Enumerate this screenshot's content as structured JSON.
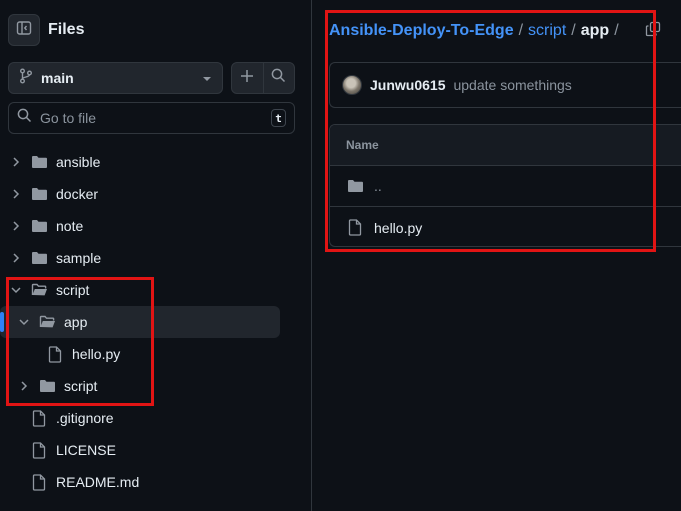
{
  "sidebar": {
    "title": "Files",
    "branch": "main",
    "search_placeholder": "Go to file",
    "search_shortcut": "t",
    "tree": [
      {
        "label": "ansible",
        "type": "folder",
        "expanded": false,
        "depth": 0
      },
      {
        "label": "docker",
        "type": "folder",
        "expanded": false,
        "depth": 0
      },
      {
        "label": "note",
        "type": "folder",
        "expanded": false,
        "depth": 0
      },
      {
        "label": "sample",
        "type": "folder",
        "expanded": false,
        "depth": 0
      },
      {
        "label": "script",
        "type": "folder",
        "expanded": true,
        "depth": 0
      },
      {
        "label": "app",
        "type": "folder",
        "expanded": true,
        "depth": 1,
        "selected": true
      },
      {
        "label": "hello.py",
        "type": "file",
        "depth": 2
      },
      {
        "label": "script",
        "type": "folder",
        "expanded": false,
        "depth": 1
      },
      {
        "label": ".gitignore",
        "type": "file",
        "depth": 0
      },
      {
        "label": "LICENSE",
        "type": "file",
        "depth": 0
      },
      {
        "label": "README.md",
        "type": "file",
        "depth": 0
      }
    ]
  },
  "breadcrumb": {
    "repo": "Ansible-Deploy-To-Edge",
    "sep1": "/",
    "folder": "script",
    "sep2": "/",
    "current": "app",
    "sep3": "/"
  },
  "commit": {
    "author": "Junwu0615",
    "message": "update somethings"
  },
  "file_table": {
    "header": "Name",
    "rows": [
      {
        "label": "..",
        "type": "folder"
      },
      {
        "label": "hello.py",
        "type": "file"
      }
    ]
  },
  "colors": {
    "background": "#0d1117",
    "link": "#4493f8",
    "highlight": "#e11414",
    "selection_bar": "#2f81f7"
  }
}
